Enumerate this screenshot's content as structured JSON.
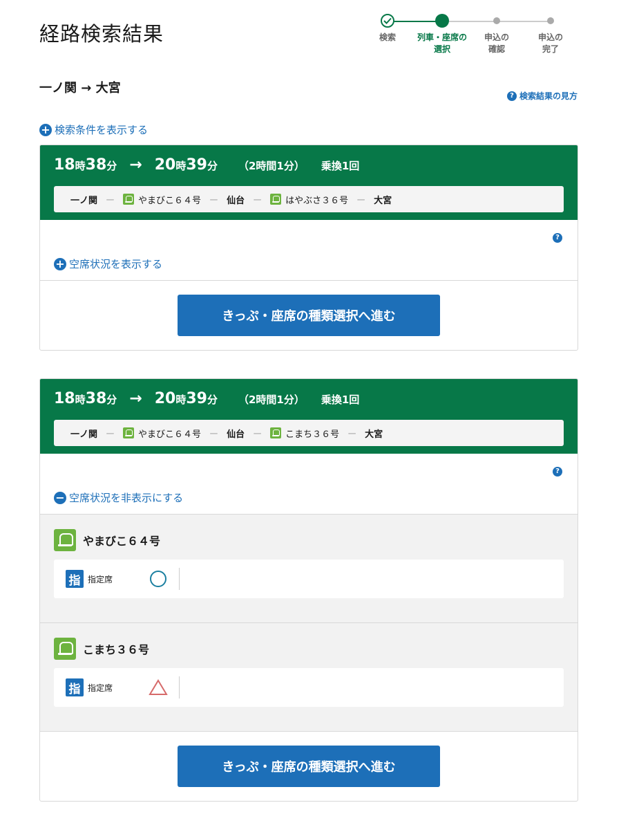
{
  "page": {
    "title": "経路検索結果"
  },
  "stepper": {
    "steps": [
      {
        "label1": "検索",
        "label2": ""
      },
      {
        "label1": "列車・座席の",
        "label2": "選択"
      },
      {
        "label1": "申込の",
        "label2": "確認"
      },
      {
        "label1": "申込の",
        "label2": "完了"
      }
    ]
  },
  "route": {
    "heading": "一ノ関 → 大宮",
    "help_link": "検索結果の見方",
    "help_icon": "?"
  },
  "search_conditions": {
    "toggle_label": "検索条件を表示する",
    "icon": "+"
  },
  "results": [
    {
      "dep_hour": "18",
      "dep_min": "38",
      "arr_hour": "20",
      "arr_min": "39",
      "unit_hour": "時",
      "unit_min": "分",
      "arrow": "→",
      "duration": "（2時間1分）",
      "transfers": "乗換1回",
      "stations": [
        "一ノ関",
        "仙台",
        "大宮"
      ],
      "trains": [
        "やまびこ６４号",
        "はやぶさ３６号"
      ],
      "dash": "ー",
      "help_icon": "?",
      "toggle_icon": "+",
      "availability_toggle": "空席状況を表示する",
      "cta": "きっぷ・座席の種類選択へ進む"
    },
    {
      "dep_hour": "18",
      "dep_min": "38",
      "arr_hour": "20",
      "arr_min": "39",
      "unit_hour": "時",
      "unit_min": "分",
      "arrow": "→",
      "duration": "（2時間1分）",
      "transfers": "乗換1回",
      "stations": [
        "一ノ関",
        "仙台",
        "大宮"
      ],
      "trains": [
        "やまびこ６４号",
        "こまち３６号"
      ],
      "dash": "ー",
      "help_icon": "?",
      "toggle_icon": "−",
      "availability_toggle": "空席状況を非表示にする",
      "seats": [
        {
          "train": "やまびこ６４号",
          "badge": "指",
          "seat_type": "指定席",
          "status": "available",
          "status_color": "#1a7fa0"
        },
        {
          "train": "こまち３６号",
          "badge": "指",
          "seat_type": "指定席",
          "status": "few-left",
          "status_color": "#d66a6a"
        }
      ],
      "cta": "きっぷ・座席の種類選択へ進む"
    }
  ]
}
